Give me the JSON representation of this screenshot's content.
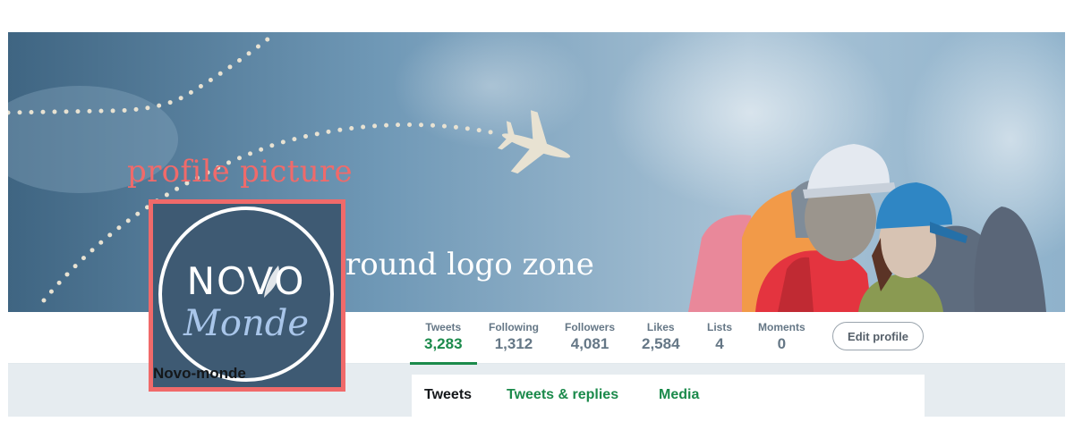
{
  "annotations": {
    "profile_picture": "profile picture",
    "round_logo_zone": "round logo zone"
  },
  "avatar": {
    "logo_top": "NOVO",
    "logo_bottom": "Monde"
  },
  "profile": {
    "name": "Novo-monde"
  },
  "stats": [
    {
      "label": "Tweets",
      "value": "3,283",
      "active": true
    },
    {
      "label": "Following",
      "value": "1,312"
    },
    {
      "label": "Followers",
      "value": "4,081"
    },
    {
      "label": "Likes",
      "value": "2,584"
    },
    {
      "label": "Lists",
      "value": "4"
    },
    {
      "label": "Moments",
      "value": "0"
    }
  ],
  "actions": {
    "edit_profile": "Edit profile"
  },
  "tabs": [
    {
      "label": "Tweets",
      "active": true
    },
    {
      "label": "Tweets & replies"
    },
    {
      "label": "Media"
    }
  ],
  "colors": {
    "accent_green": "#1b8a4b",
    "annotation_red": "#f06a6a",
    "avatar_bg": "#3e5a73"
  },
  "icons": [
    "airplane-icon",
    "compass-icon",
    "feather-icon"
  ]
}
